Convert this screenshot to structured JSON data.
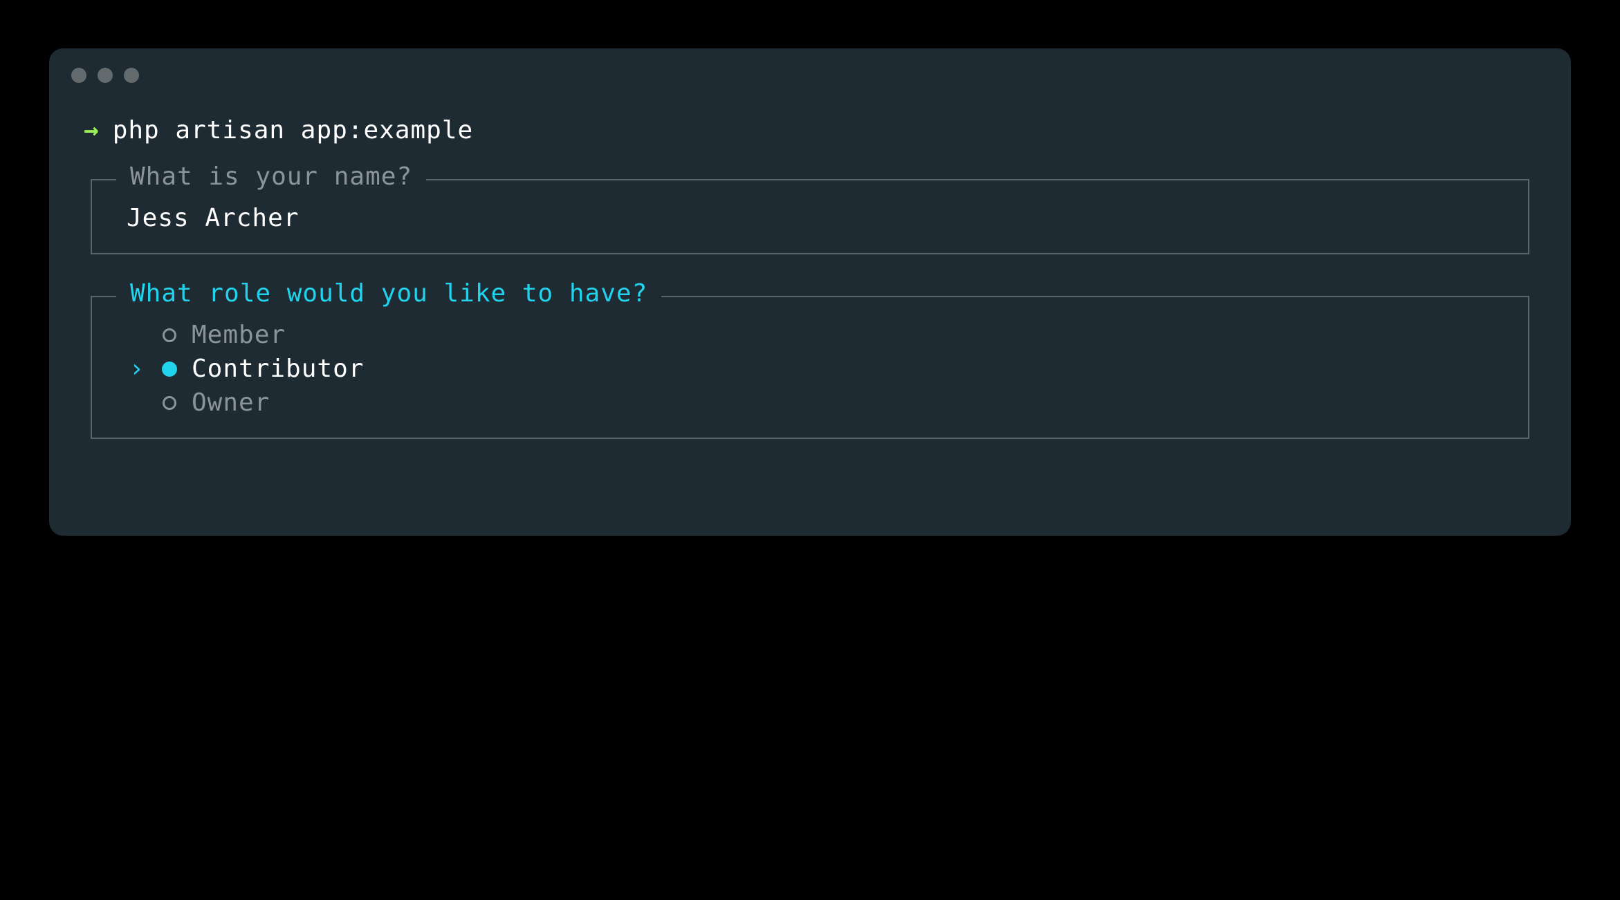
{
  "command": "php artisan app:example",
  "prompts": {
    "name": {
      "question": "What is your name?",
      "value": "Jess Archer"
    },
    "role": {
      "question": "What role would you like to have?",
      "options": [
        {
          "label": "Member",
          "selected": false
        },
        {
          "label": "Contributor",
          "selected": true
        },
        {
          "label": "Owner",
          "selected": false
        }
      ]
    }
  },
  "colors": {
    "background": "#1e2b32",
    "accent": "#22d3ee",
    "prompt_arrow": "#9bef5a",
    "border": "#5a6469",
    "muted": "#8a9499"
  }
}
